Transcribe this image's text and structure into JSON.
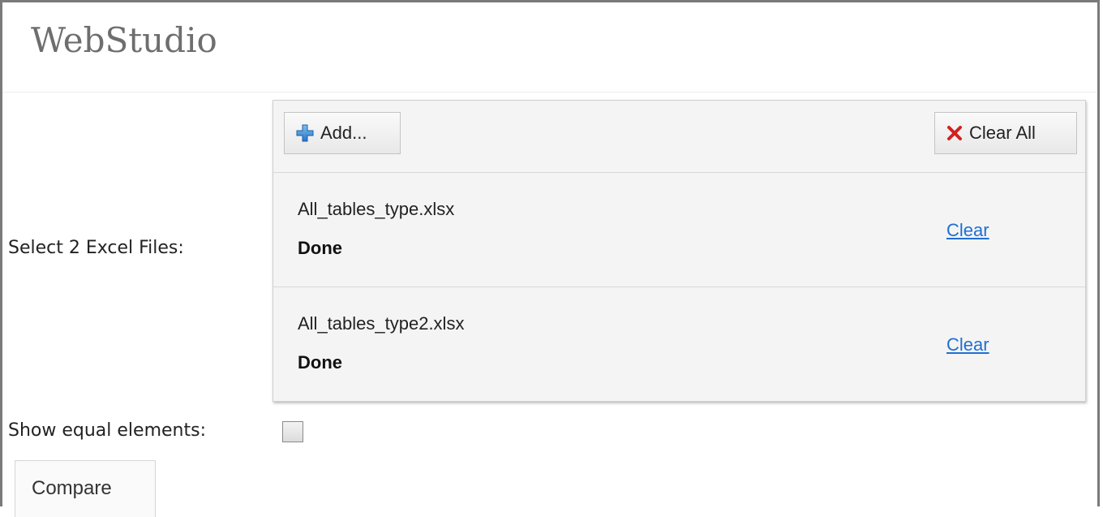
{
  "app": {
    "title": "WebStudio"
  },
  "form": {
    "files_label": "Select 2 Excel Files:",
    "show_equal_label": "Show equal elements:",
    "show_equal_checked": false,
    "compare_label": "Compare"
  },
  "uploader": {
    "add_label": "Add...",
    "clear_all_label": "Clear All",
    "files": [
      {
        "name": "All_tables_type.xlsx",
        "status": "Done",
        "clear_label": "Clear"
      },
      {
        "name": "All_tables_type2.xlsx",
        "status": "Done",
        "clear_label": "Clear"
      }
    ]
  },
  "colors": {
    "link": "#1f6fd1",
    "add_icon": "#2e7fd0",
    "clear_icon": "#d42020"
  },
  "icons": {
    "add": "plus-icon",
    "clear_all": "x-icon"
  }
}
